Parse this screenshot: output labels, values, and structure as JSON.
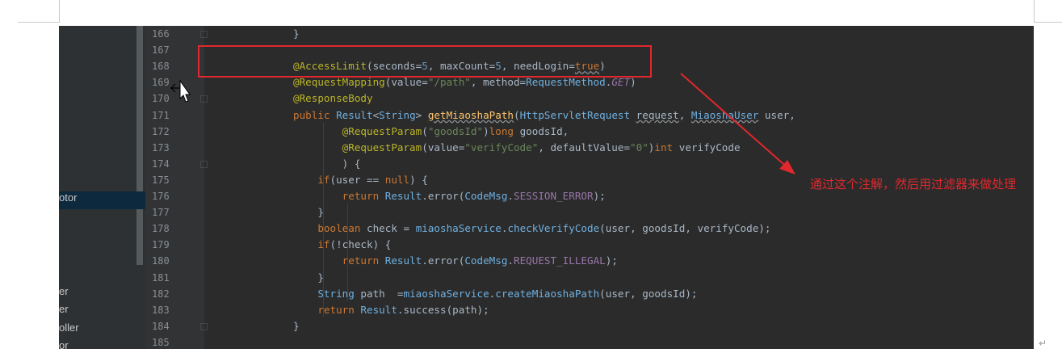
{
  "sidebar": {
    "items": [
      {
        "label": "otor",
        "selected": true
      },
      {
        "label": "er",
        "selected": false
      },
      {
        "label": "er",
        "selected": false
      },
      {
        "label": "oller",
        "selected": false
      },
      {
        "label": "or",
        "selected": false
      }
    ]
  },
  "editor": {
    "line_numbers": [
      "166",
      "167",
      "168",
      "169",
      "170",
      "171",
      "172",
      "173",
      "174",
      "175",
      "176",
      "177",
      "178",
      "179",
      "180",
      "181",
      "182",
      "183",
      "184",
      "185"
    ],
    "lines": [
      [
        {
          "t": "}",
          "c": "plain"
        }
      ],
      [],
      [
        {
          "t": "@AccessLimit",
          "c": "anno"
        },
        {
          "t": "(seconds=",
          "c": "plain"
        },
        {
          "t": "5",
          "c": "num"
        },
        {
          "t": ", maxCount=",
          "c": "plain"
        },
        {
          "t": "5",
          "c": "num"
        },
        {
          "t": ", needLogin=",
          "c": "plain"
        },
        {
          "t": "true",
          "c": "kw warn"
        },
        {
          "t": ")",
          "c": "plain"
        }
      ],
      [
        {
          "t": "@RequestMapping",
          "c": "anno"
        },
        {
          "t": "(value=",
          "c": "plain"
        },
        {
          "t": "\"/path\"",
          "c": "str"
        },
        {
          "t": ", method=",
          "c": "plain"
        },
        {
          "t": "RequestMethod",
          "c": "cls"
        },
        {
          "t": ".",
          "c": "plain"
        },
        {
          "t": "GET",
          "c": "ital"
        },
        {
          "t": ")",
          "c": "plain"
        }
      ],
      [
        {
          "t": "@ResponseBody",
          "c": "anno"
        }
      ],
      [
        {
          "t": "public ",
          "c": "kw"
        },
        {
          "t": "Result",
          "c": "cls"
        },
        {
          "t": "<",
          "c": "plain"
        },
        {
          "t": "String",
          "c": "cls"
        },
        {
          "t": "> ",
          "c": "plain"
        },
        {
          "t": "getMiaoshaPath",
          "c": "call warn"
        },
        {
          "t": "(",
          "c": "plain"
        },
        {
          "t": "HttpServletRequest",
          "c": "cls"
        },
        {
          "t": " ",
          "c": "plain"
        },
        {
          "t": "request",
          "c": "plain warn"
        },
        {
          "t": ", ",
          "c": "plain"
        },
        {
          "t": "MiaoshaUser",
          "c": "cls warn"
        },
        {
          "t": " user,",
          "c": "plain"
        }
      ],
      [
        {
          "t": "        @RequestParam",
          "c": "anno"
        },
        {
          "t": "(",
          "c": "plain"
        },
        {
          "t": "\"goodsId\"",
          "c": "str"
        },
        {
          "t": ")",
          "c": "plain"
        },
        {
          "t": "long ",
          "c": "kw"
        },
        {
          "t": "goodsId,",
          "c": "plain"
        }
      ],
      [
        {
          "t": "        @RequestParam",
          "c": "anno"
        },
        {
          "t": "(value=",
          "c": "plain"
        },
        {
          "t": "\"verifyCode\"",
          "c": "str"
        },
        {
          "t": ", defaultValue=",
          "c": "plain"
        },
        {
          "t": "\"0\"",
          "c": "str"
        },
        {
          "t": ")",
          "c": "plain"
        },
        {
          "t": "int ",
          "c": "kw"
        },
        {
          "t": "verifyCode",
          "c": "plain"
        }
      ],
      [
        {
          "t": "        ) {",
          "c": "plain"
        }
      ],
      [
        {
          "t": "    ",
          "c": "plain"
        },
        {
          "t": "if",
          "c": "kw"
        },
        {
          "t": "(user == ",
          "c": "plain"
        },
        {
          "t": "null",
          "c": "kw"
        },
        {
          "t": ") {",
          "c": "plain"
        }
      ],
      [
        {
          "t": "        ",
          "c": "plain"
        },
        {
          "t": "return ",
          "c": "kw"
        },
        {
          "t": "Result",
          "c": "cls"
        },
        {
          "t": ".error(",
          "c": "plain"
        },
        {
          "t": "CodeMsg",
          "c": "cls"
        },
        {
          "t": ".",
          "c": "plain"
        },
        {
          "t": "SESSION_ERROR",
          "c": "fld"
        },
        {
          "t": ");",
          "c": "plain"
        }
      ],
      [
        {
          "t": "    }",
          "c": "plain"
        }
      ],
      [
        {
          "t": "    ",
          "c": "plain"
        },
        {
          "t": "boolean ",
          "c": "kw"
        },
        {
          "t": "check = ",
          "c": "plain"
        },
        {
          "t": "miaoshaService",
          "c": "cls"
        },
        {
          "t": ".",
          "c": "plain"
        },
        {
          "t": "checkVerifyCode",
          "c": "cls"
        },
        {
          "t": "(user, goodsId, verifyCode);",
          "c": "plain"
        }
      ],
      [
        {
          "t": "    ",
          "c": "plain"
        },
        {
          "t": "if",
          "c": "kw"
        },
        {
          "t": "(!check) {",
          "c": "plain"
        }
      ],
      [
        {
          "t": "        ",
          "c": "plain"
        },
        {
          "t": "return ",
          "c": "kw"
        },
        {
          "t": "Result",
          "c": "cls"
        },
        {
          "t": ".error(",
          "c": "plain"
        },
        {
          "t": "CodeMsg",
          "c": "cls"
        },
        {
          "t": ".",
          "c": "plain"
        },
        {
          "t": "REQUEST_ILLEGAL",
          "c": "fld"
        },
        {
          "t": ");",
          "c": "plain"
        }
      ],
      [
        {
          "t": "    }",
          "c": "plain"
        }
      ],
      [
        {
          "t": "    ",
          "c": "plain"
        },
        {
          "t": "String",
          "c": "cls"
        },
        {
          "t": " path  =",
          "c": "plain"
        },
        {
          "t": "miaoshaService",
          "c": "cls"
        },
        {
          "t": ".",
          "c": "plain"
        },
        {
          "t": "createMiaoshaPath",
          "c": "cls"
        },
        {
          "t": "(user, goodsId);",
          "c": "plain"
        }
      ],
      [
        {
          "t": "    ",
          "c": "plain"
        },
        {
          "t": "return ",
          "c": "kw"
        },
        {
          "t": "Result",
          "c": "cls"
        },
        {
          "t": ".success(path);",
          "c": "plain"
        }
      ],
      [
        {
          "t": "}",
          "c": "plain"
        }
      ],
      []
    ]
  },
  "annotation": {
    "note": "通过这个注解，然后用过滤器来做处理",
    "color": "#e0282d"
  },
  "document": {
    "paragraph_mark": "↵"
  }
}
